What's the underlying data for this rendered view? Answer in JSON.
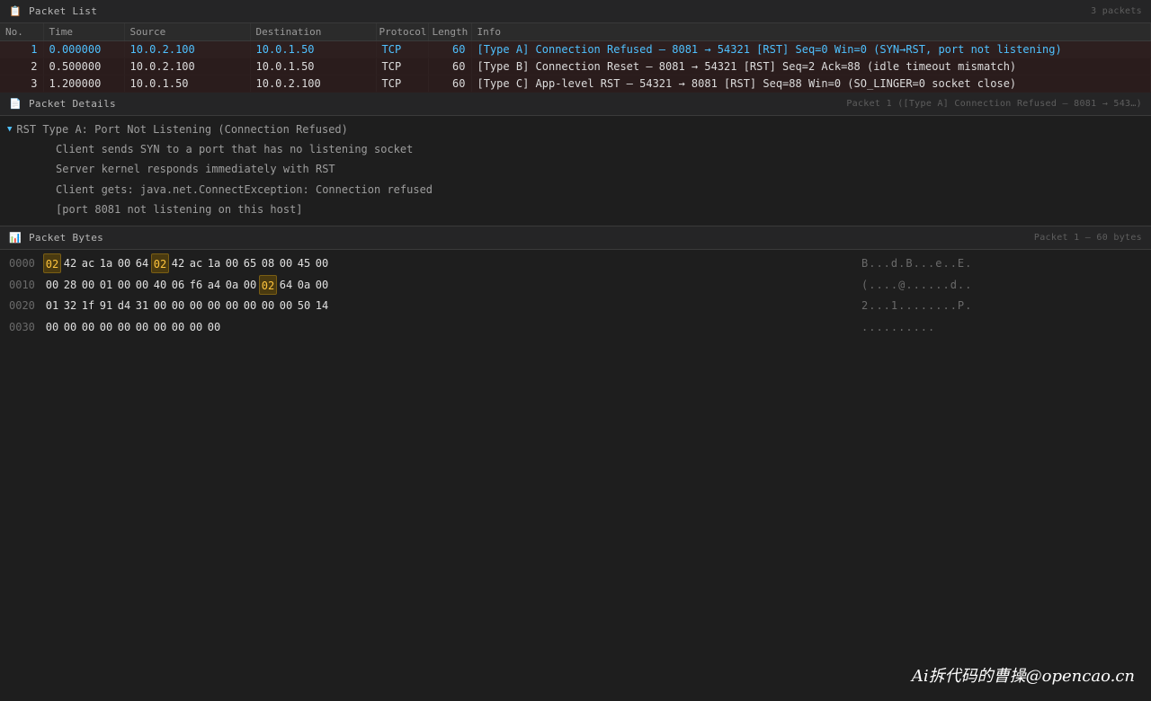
{
  "packet_list": {
    "icon": "clipboard-icon",
    "title": "Packet List",
    "count": "3 packets",
    "columns": [
      "No.",
      "Time",
      "Source",
      "Destination",
      "Protocol",
      "Length",
      "Info"
    ],
    "rows": [
      {
        "no": "1",
        "time": "0.000000",
        "source": "10.0.2.100",
        "destination": "10.0.1.50",
        "protocol": "TCP",
        "length": "60",
        "info": "[Type A] Connection Refused — 8081 → 54321 [RST] Seq=0 Win=0 (SYN→RST, port not listening)"
      },
      {
        "no": "2",
        "time": "0.500000",
        "source": "10.0.2.100",
        "destination": "10.0.1.50",
        "protocol": "TCP",
        "length": "60",
        "info": "[Type B] Connection Reset — 8081 → 54321 [RST] Seq=2 Ack=88 (idle timeout mismatch)"
      },
      {
        "no": "3",
        "time": "1.200000",
        "source": "10.0.1.50",
        "destination": "10.0.2.100",
        "protocol": "TCP",
        "length": "60",
        "info": "[Type C] App-level RST — 54321 → 8081 [RST] Seq=88 Win=0 (SO_LINGER=0 socket close)"
      }
    ],
    "selected_index": 0,
    "selected_color": "#4fc1ff",
    "rst_color": "#f0543c"
  },
  "packet_details": {
    "icon": "document-icon",
    "title": "Packet Details",
    "meta": "Packet 1 ([Type A] Connection Refused — 8081 → 543…)",
    "node": {
      "label": "RST Type A: Port Not Listening (Connection Refused)",
      "expanded": true,
      "children": [
        "Client sends SYN to a port that has no listening socket",
        "Server kernel responds immediately with RST",
        "Client gets: java.net.ConnectException: Connection refused",
        "[port 8081 not listening on this host]"
      ]
    }
  },
  "packet_bytes": {
    "icon": "bar-chart-icon",
    "title": "Packet Bytes",
    "meta": "Packet 1 — 60 bytes",
    "highlight_color": "#ffc53d",
    "rows": [
      {
        "offset": "0000",
        "hex": [
          "02",
          "42",
          "ac",
          "1a",
          "00",
          "64",
          "02",
          "42",
          "ac",
          "1a",
          "00",
          "65",
          "08",
          "00",
          "45",
          "00"
        ],
        "highlight": [
          0,
          6
        ],
        "ascii": "B...d.B...e..E."
      },
      {
        "offset": "0010",
        "hex": [
          "00",
          "28",
          "00",
          "01",
          "00",
          "00",
          "40",
          "06",
          "f6",
          "a4",
          "0a",
          "00",
          "02",
          "64",
          "0a",
          "00"
        ],
        "highlight": [
          12
        ],
        "ascii": "(....@......d.."
      },
      {
        "offset": "0020",
        "hex": [
          "01",
          "32",
          "1f",
          "91",
          "d4",
          "31",
          "00",
          "00",
          "00",
          "00",
          "00",
          "00",
          "00",
          "00",
          "50",
          "14"
        ],
        "highlight": [],
        "ascii": "2...1........P."
      },
      {
        "offset": "0030",
        "hex": [
          "00",
          "00",
          "00",
          "00",
          "00",
          "00",
          "00",
          "00",
          "00",
          "00"
        ],
        "highlight": [],
        "ascii": ".........."
      }
    ]
  },
  "watermark": "Ai拆代码的曹操@opencao.cn"
}
